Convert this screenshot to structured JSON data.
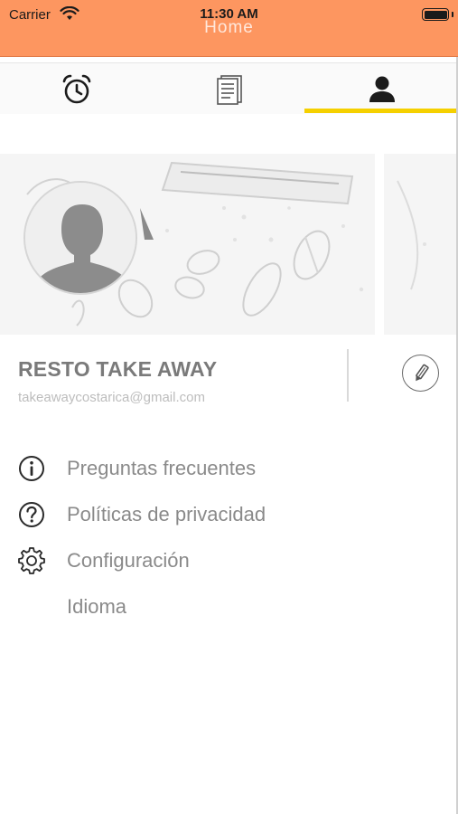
{
  "status_bar": {
    "carrier": "Carrier",
    "time": "11:30 AM"
  },
  "nav": {
    "title": "Home"
  },
  "tabs": [
    {
      "icon": "alarm-clock-icon",
      "selected": false
    },
    {
      "icon": "document-list-icon",
      "selected": false
    },
    {
      "icon": "user-icon",
      "selected": true
    }
  ],
  "profile": {
    "name": "RESTO TAKE AWAY",
    "email": "takeawaycostarica@gmail.com"
  },
  "menu": [
    {
      "icon": "info-icon",
      "label": "Preguntas frecuentes"
    },
    {
      "icon": "question-icon",
      "label": "Políticas de privacidad"
    },
    {
      "icon": "gear-icon",
      "label": "Configuración"
    },
    {
      "icon": "",
      "label": "Idioma"
    }
  ],
  "colors": {
    "header": "#fd9660",
    "tab_indicator": "#f5d000",
    "text_muted": "#8a8a8a"
  }
}
